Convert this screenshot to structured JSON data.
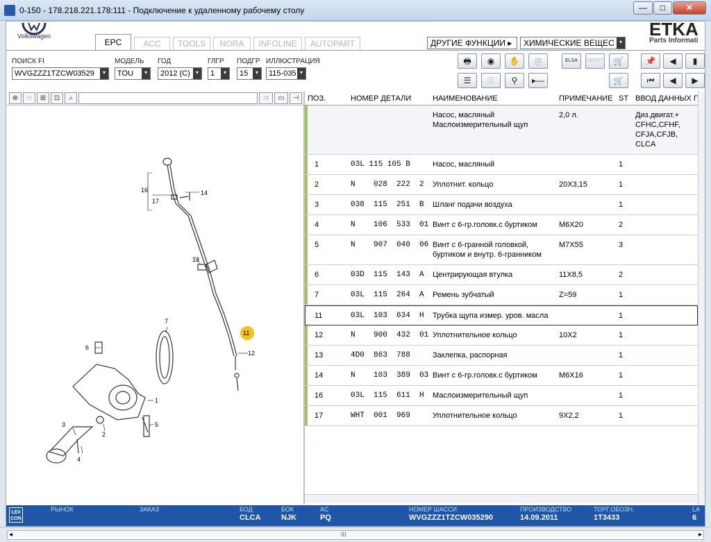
{
  "window": {
    "title": "0-150 - 178.218.221.178:111 - Подключение к удаленному рабочему столу",
    "min": "—",
    "max": "□",
    "close": "✕"
  },
  "brand": {
    "vw_label": "Volkswagen",
    "etka": "ETKA",
    "etka_sub": "Parts Informati"
  },
  "tabs": [
    "EPC",
    "ACC",
    "TOOLS",
    "NORA",
    "INFOLINE",
    "AUTOPART"
  ],
  "functions": {
    "other": "ДРУГИЕ ФУНКЦИИ",
    "other_arrow": "▸",
    "chemicals": "ХИМИЧЕСКИЕ ВЕЩЕС",
    "arrow": "▾"
  },
  "filters": [
    {
      "label": "ПОИСК FI",
      "value": "WVGZZZ1TZCW03529"
    },
    {
      "label": "МОДЕЛЬ",
      "value": "TOU"
    },
    {
      "label": "ГОД",
      "value": "2012 (C)"
    },
    {
      "label": "ГЛГР",
      "value": "1"
    },
    {
      "label": "ПОДГР",
      "value": "15"
    },
    {
      "label": "ИЛЛЮСТРАЦИЯ",
      "value": "115-035"
    }
  ],
  "toolbar_icons": {
    "print": "🖶",
    "disc": "◉",
    "handshake": "✋",
    "mail": "@",
    "elsa": "ELSA",
    "depot": "DEPOT",
    "cart_in": "🛒",
    "pin": "📌",
    "book_prev": "◀",
    "book": "▮",
    "list": "☰",
    "key": "⚿",
    "bike": "⚲",
    "pointer": "▸—",
    "cart": "🛒",
    "first": "⏮",
    "prev": "◀",
    "next": "▶"
  },
  "table": {
    "headers": [
      "ПОЗ.",
      "НОМЕР ДЕТАЛИ",
      "НАИМЕНОВАНИЕ",
      "ПРИМЕЧАНИЕ",
      "ST",
      "ВВОД ДАННЫХ П"
    ],
    "header_row": {
      "name1": "Насос, масляный",
      "name2": "Маслоизмерительный щуп",
      "note": "2,0 л.",
      "input1": "Диз.двигат.+",
      "input2": "CFHC,CFHF,",
      "input3": "CFJA,CFJB,",
      "input4": "CLCA"
    },
    "rows": [
      {
        "pos": "1",
        "part": "03L  115  105  B",
        "name": "Насос, масляный",
        "note": "",
        "st": "1"
      },
      {
        "pos": "2",
        "part": "N    028  222  2",
        "name": "Уплотнит. кольцо",
        "note": "20X3,15",
        "st": "1"
      },
      {
        "pos": "3",
        "part": "038  115  251  B",
        "name": "Шланг подачи воздуха",
        "note": "",
        "st": "1"
      },
      {
        "pos": "4",
        "part": "N    106  533  01",
        "name": "Винт с 6-гр.головк.с буртиком",
        "note": "M6X20",
        "st": "2"
      },
      {
        "pos": "5",
        "part": "N    907  040  06",
        "name": "Винт с 6-гранной головкой,",
        "name2": "буртиком и внутр. 6-гранником",
        "note": "M7X55",
        "st": "3"
      },
      {
        "pos": "6",
        "part": "03D  115  143  A",
        "name": "Центрирующая втулка",
        "note": "11X8,5",
        "st": "2"
      },
      {
        "pos": "7",
        "part": "03L  115  264  A",
        "name": "Ремень зубчатый",
        "note": "Z=59",
        "st": "1"
      },
      {
        "pos": "11",
        "part": "03L  103  634  H",
        "name": "Трубка щупа измер. уров. масла",
        "note": "",
        "st": "1"
      },
      {
        "pos": "12",
        "part": "N    900  432  01",
        "name": "Уплотнительное кольцо",
        "note": "10X2",
        "st": "1"
      },
      {
        "pos": "13",
        "part": "4D0  863  788",
        "name": "Заклепка, распорная",
        "note": "",
        "st": "1"
      },
      {
        "pos": "14",
        "part": "N    103  389  03",
        "name": "Винт с 6-гр.головк.с буртиком",
        "note": "M6X16",
        "st": "1"
      },
      {
        "pos": "16",
        "part": "03L  115  611  H",
        "name": "Маслоизмерительный щуп",
        "note": "",
        "st": "1"
      },
      {
        "pos": "17",
        "part": "WHT  001  969",
        "name": "Уплотнительное кольцо",
        "note": "9X2,2",
        "st": "1"
      }
    ]
  },
  "diagram": {
    "labels": [
      "16",
      "17",
      "14",
      "13",
      "11",
      "12",
      "7",
      "6",
      "1",
      "3",
      "2",
      "5",
      "4"
    ],
    "highlight": "11"
  },
  "footer": {
    "lexcon": "LEX CON",
    "market_label": "РЫНОК",
    "order_label": "ЗАКАЗ",
    "bod_label": "БОД",
    "bod": "CLCA",
    "bok_label": "БОК",
    "bok": "NJK",
    "ac_label": "AC",
    "ac": "PQ",
    "chassis_label": "НОМЕР ШАССИ",
    "chassis": "WVGZZZ1TZCW035290",
    "prod_label": "ПРОИЗВОДСТВО",
    "prod": "14.09.2011",
    "torg_label": "ТОРГ.ОБОЗН.",
    "torg": "1T3433",
    "last_label": "LA",
    "last": "6"
  },
  "scroll": {
    "grip": "III",
    "left": "◂",
    "right": "▸"
  }
}
